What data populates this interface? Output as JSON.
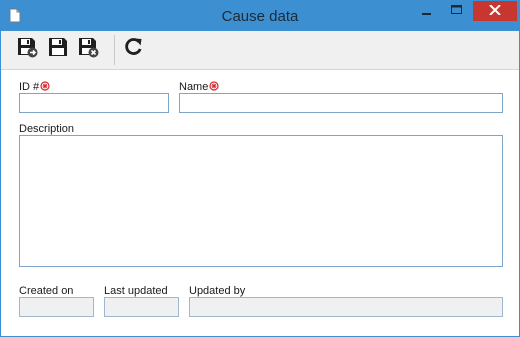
{
  "window": {
    "title": "Cause data",
    "doc_icon": "document-icon",
    "controls": {
      "minimize": "minimize-icon",
      "maximize": "maximize-icon",
      "close": "close-icon"
    },
    "close_color": "#c7372f",
    "accent": "#3c8fd0"
  },
  "toolbar": {
    "buttons": [
      {
        "icon": "save-and-new-icon"
      },
      {
        "icon": "save-icon"
      },
      {
        "icon": "save-and-close-icon"
      },
      {
        "icon": "refresh-icon"
      }
    ]
  },
  "form": {
    "id_label": "ID #",
    "id_value": "",
    "name_label": "Name",
    "name_value": "",
    "required_marker_color": "#d9262c",
    "description_label": "Description",
    "description_value": "",
    "created_on_label": "Created on",
    "created_on_value": "",
    "last_updated_label": "Last updated",
    "last_updated_value": "",
    "updated_by_label": "Updated by",
    "updated_by_value": ""
  }
}
